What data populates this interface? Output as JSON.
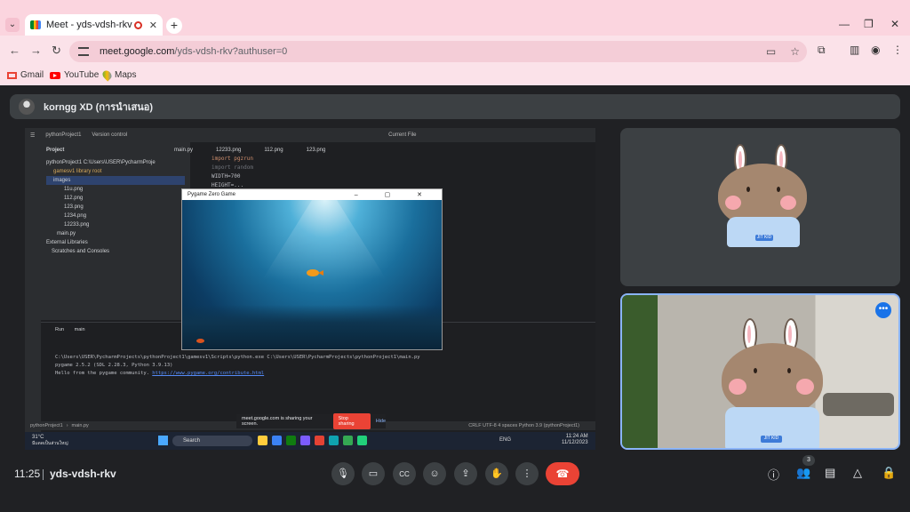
{
  "browser": {
    "tab_title": "Meet - yds-vdsh-rkv",
    "url_main": "meet.google.com",
    "url_rest": "/yds-vdsh-rkv?authuser=0",
    "bookmarks": [
      "Gmail",
      "YouTube",
      "Maps"
    ]
  },
  "meet": {
    "presenter_name": "korngg XD (การนำเสนอ)",
    "time": "11:25",
    "meeting_code": "yds-vdsh-rkv",
    "participant_count": "3",
    "end_color": "#ea4335"
  },
  "ide": {
    "project_menu": "pythonProject1",
    "vcs_menu": "Version control",
    "run_config": "Current File",
    "project_label": "Project",
    "tree": [
      "pythonProject1 C:\\Users\\USER\\PycharmProje",
      "gamesv1 library root",
      "images",
      "11u.png",
      "112.png",
      "123.png",
      "1234.png",
      "12233.png",
      "main.py",
      "External Libraries",
      "Scratches and Consoles"
    ],
    "editor_tabs": [
      "main.py",
      "12233.png",
      "112.png",
      "123.png"
    ],
    "code_lines": [
      "import pgzrun",
      "import random",
      "WIDTH=700",
      "HEIGHT=..."
    ],
    "run_tab": "Run",
    "run_name": "main",
    "console": [
      "C:\\Users\\USER\\PycharmProjects\\pythonProject1\\gamesv1\\Scripts\\python.exe C:\\Users\\USER\\PycharmProjects\\pythonProject1\\main.py",
      "pygame 2.5.2 (SDL 2.28.3, Python 3.9.13)",
      "Hello from the pygame community."
    ],
    "console_link": "https://www.pygame.org/contribute.html",
    "status": [
      "pythonProject1",
      "main.py"
    ],
    "status_right": "CRLF   UTF-8   4 spaces   Python 3.9 (pythonProject1)",
    "game_title": "Pygame Zero Game"
  },
  "sharing": {
    "message": "meet.google.com is sharing your screen.",
    "stop_label": "Stop sharing",
    "hide_label": "Hide"
  },
  "taskbar": {
    "weather_temp": "31°C",
    "weather_text": "มีแดดเป็นส่วนใหญ่",
    "search_label": "Search",
    "lang": "ENG",
    "time": "11:24 AM",
    "date": "11/12/2023"
  },
  "tiles": {
    "badge_text": "JIT KID"
  }
}
